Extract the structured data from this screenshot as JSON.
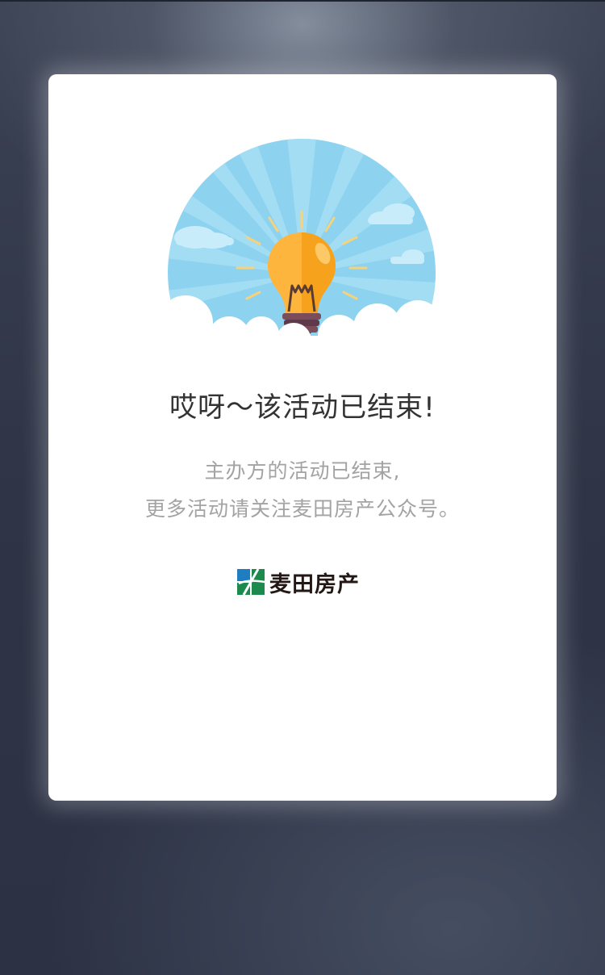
{
  "page": {
    "headline": "哎呀～该活动已结束!",
    "description_line1": "主办方的活动已结束,",
    "description_line2": "更多活动请关注麦田房产公众号。"
  },
  "brand": {
    "name": "麦田房产",
    "colors": {
      "blue": "#1f7ec2",
      "green": "#1b8a4c"
    }
  },
  "illustration": {
    "icon": "lightbulb-icon",
    "sky_color": "#8dd3f0",
    "bulb_color": "#fdb53d"
  },
  "colors": {
    "headline": "#333333",
    "description": "#a3a3a3",
    "card": "#ffffff"
  }
}
